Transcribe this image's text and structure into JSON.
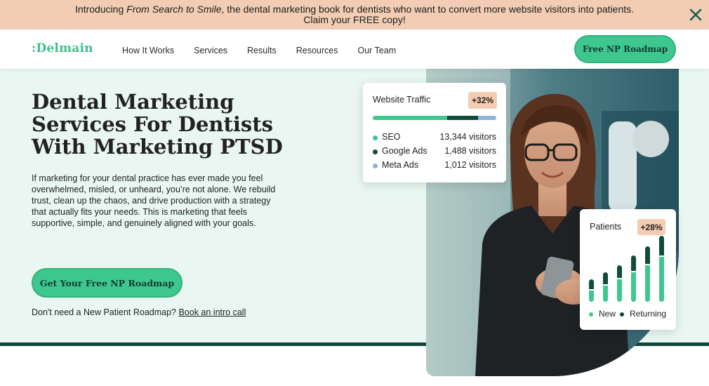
{
  "announcement": {
    "prefix": "Introducing ",
    "book_title": "From Search to Smile",
    "suffix": ", the dental marketing book for dentists who want to convert more website visitors into patients.",
    "line2": "Claim your FREE copy!"
  },
  "header": {
    "logo": ":Delmain",
    "nav": [
      "How It Works",
      "Services",
      "Results",
      "Resources",
      "Our Team"
    ],
    "cta": "Free NP Roadmap"
  },
  "hero": {
    "headline_lines": [
      "Dental Marketing",
      "Services For Dentists",
      "With Marketing PTSD"
    ],
    "body": "If marketing for your dental practice has ever made you feel overwhelmed, misled, or unheard, you’re not alone. We rebuild trust, clean up the chaos, and drive production with a strategy that actually fits your needs. This is marketing that feels supportive, simple, and genuinely aligned with your goals.",
    "cta": "Get Your Free NP Roadmap",
    "intro_prefix": "Don't need a New Patient Roadmap? ",
    "intro_link": "Book an intro call"
  },
  "traffic_card": {
    "title": "Website Traffic",
    "badge": "+32%",
    "sources": [
      {
        "name": "SEO",
        "value": "13,344 visitors",
        "visitors": 13344,
        "color": "#3ec78f"
      },
      {
        "name": "Google Ads",
        "value": "1,488 visitors",
        "visitors": 1488,
        "color": "#0f4c3b"
      },
      {
        "name": "Meta Ads",
        "value": "1,012 visitors",
        "visitors": 1012,
        "color": "#8fb4d9"
      }
    ]
  },
  "patients_card": {
    "title": "Patients",
    "badge": "+28%",
    "legend": [
      "New",
      "Returning"
    ],
    "bars": [
      {
        "new": 0.22,
        "returning": 0.16
      },
      {
        "new": 0.3,
        "returning": 0.2
      },
      {
        "new": 0.4,
        "returning": 0.22
      },
      {
        "new": 0.52,
        "returning": 0.26
      },
      {
        "new": 0.64,
        "returning": 0.3
      },
      {
        "new": 0.78,
        "returning": 0.34
      }
    ],
    "colors": {
      "new": "#3ec78f",
      "returning": "#0f4c3b"
    }
  },
  "colors": {
    "accent": "#3ec78f",
    "dark_green": "#0f4c3b",
    "announcement_bg": "#f2cdb4",
    "hero_bg": "#e9f6f1"
  }
}
